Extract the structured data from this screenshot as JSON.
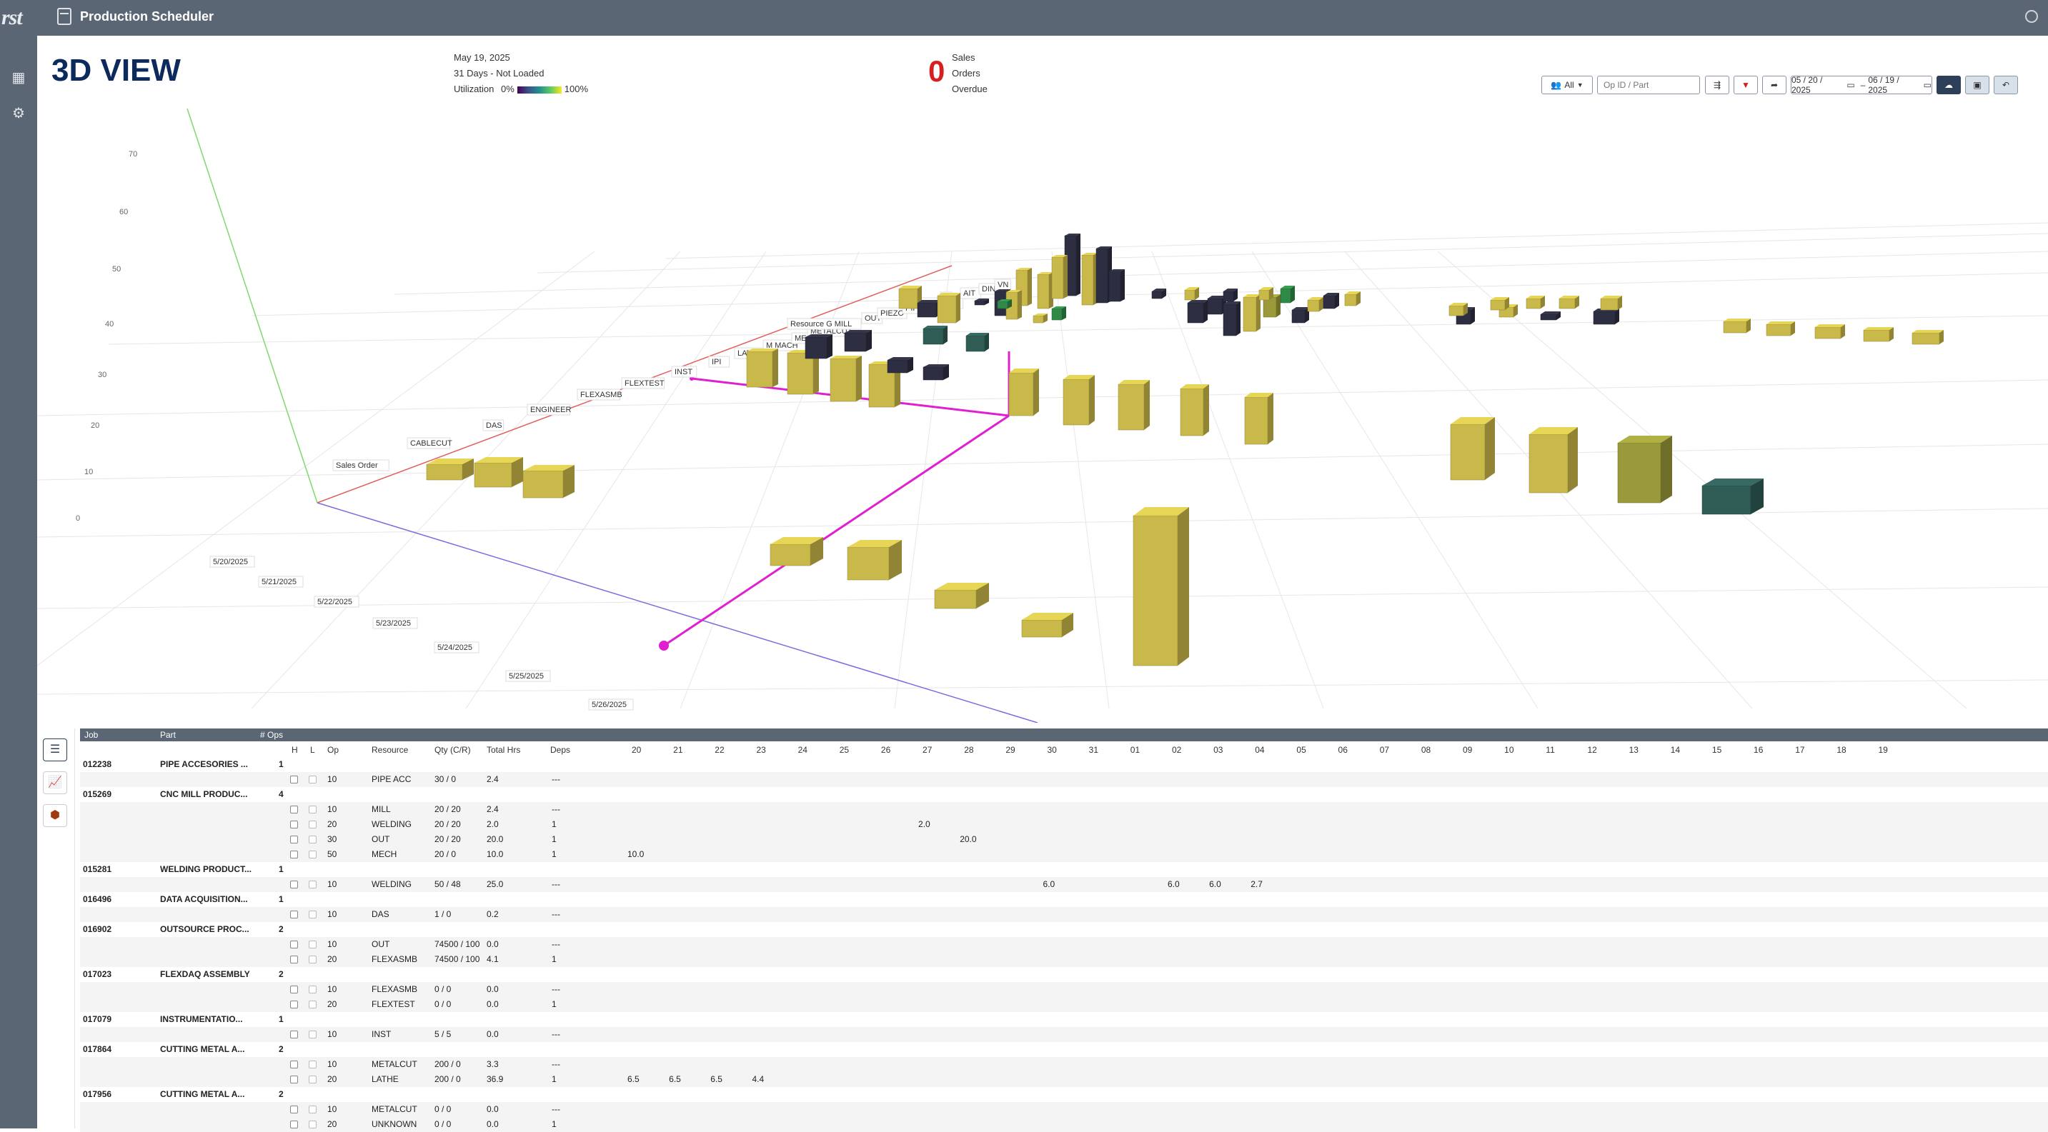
{
  "app": {
    "logo": "rst",
    "title": "Production Scheduler"
  },
  "sidebar": {
    "items": [
      {
        "name": "calendar-icon"
      },
      {
        "name": "tools-icon"
      }
    ]
  },
  "header": {
    "view_title": "3D VIEW",
    "date": "May 19, 2025",
    "days": "31 Days - Not Loaded",
    "utilization_label": "Utilization",
    "utilization_min": "0%",
    "utilization_max": "100%",
    "overdue_count": "0",
    "overdue_lines": [
      "Sales",
      "Orders",
      "Overdue"
    ]
  },
  "toolbar": {
    "filter_all": "All",
    "search_placeholder": "Op ID / Part",
    "date_from": "05 / 20 / 2025",
    "date_sep": "–",
    "date_to": "06 / 19 / 2025"
  },
  "scene": {
    "y_ticks": [
      "70",
      "60",
      "50",
      "40",
      "30",
      "20",
      "10",
      "0"
    ],
    "resource_labels": [
      "Sales Order",
      "CABLECUT",
      "DAS",
      "ENGINEER",
      "FLEXASMB",
      "FLEXTEST",
      "INST",
      "IPI",
      "LATHE",
      "M MACH",
      "MECH",
      "METALCUT",
      "Resource G MILL",
      "OUT",
      "PIEZO",
      "PIPE",
      "PIPE ACC",
      "P",
      "AIT",
      "DING",
      "VN"
    ],
    "date_labels": [
      "5/20/2025",
      "5/21/2025",
      "5/22/2025",
      "5/23/2025",
      "5/24/2025",
      "5/25/2025",
      "5/26/2025"
    ],
    "colors": {
      "yellow": "#c9b94a",
      "dark": "#2e2e42",
      "teal": "#2f5c55",
      "green": "#2f8a48",
      "olive": "#9a9a3a",
      "magenta": "#e020d0"
    }
  },
  "grid": {
    "header": {
      "job": "Job",
      "part": "Part",
      "ops": "# Ops"
    },
    "columns": {
      "h": "H",
      "l": "L",
      "op": "Op",
      "resource": "Resource",
      "qty": "Qty (C/R)",
      "total": "Total Hrs",
      "deps": "Deps"
    },
    "days": [
      "20",
      "21",
      "22",
      "23",
      "24",
      "25",
      "26",
      "27",
      "28",
      "29",
      "30",
      "31",
      "01",
      "02",
      "03",
      "04",
      "05",
      "06",
      "07",
      "08",
      "09",
      "10",
      "11",
      "12",
      "13",
      "14",
      "15",
      "16",
      "17",
      "18",
      "19"
    ],
    "rows": [
      {
        "type": "job",
        "job": "012238",
        "part": "PIPE ACCESORIES ...",
        "ops": "1"
      },
      {
        "type": "op",
        "op": "10",
        "resource": "PIPE ACC",
        "qty": "30 / 0",
        "total": "2.4",
        "deps": "---",
        "cells": {}
      },
      {
        "type": "job",
        "job": "015269",
        "part": "CNC MILL PRODUC...",
        "ops": "4"
      },
      {
        "type": "op",
        "op": "10",
        "resource": "MILL",
        "qty": "20 / 20",
        "total": "2.4",
        "deps": "---",
        "cells": {}
      },
      {
        "type": "op",
        "op": "20",
        "resource": "WELDING",
        "qty": "20 / 20",
        "total": "2.0",
        "deps": "1",
        "cells": {
          "7": "2.0"
        }
      },
      {
        "type": "op",
        "op": "30",
        "resource": "OUT",
        "qty": "20 / 20",
        "total": "20.0",
        "deps": "1",
        "cells": {
          "8": "20.0"
        }
      },
      {
        "type": "op",
        "op": "50",
        "resource": "MECH",
        "qty": "20 / 0",
        "total": "10.0",
        "deps": "1",
        "cells": {
          "0": "10.0"
        }
      },
      {
        "type": "job",
        "job": "015281",
        "part": "WELDING PRODUCT...",
        "ops": "1"
      },
      {
        "type": "op",
        "op": "10",
        "resource": "WELDING",
        "qty": "50 / 48",
        "total": "25.0",
        "deps": "---",
        "cells": {
          "10": "6.0",
          "13": "6.0",
          "14": "6.0",
          "15": "2.7"
        }
      },
      {
        "type": "job",
        "job": "016496",
        "part": "DATA ACQUISITION...",
        "ops": "1"
      },
      {
        "type": "op",
        "op": "10",
        "resource": "DAS",
        "qty": "1 / 0",
        "total": "0.2",
        "deps": "---",
        "cells": {}
      },
      {
        "type": "job",
        "job": "016902",
        "part": "OUTSOURCE PROC...",
        "ops": "2"
      },
      {
        "type": "op",
        "op": "10",
        "resource": "OUT",
        "qty": "74500 / 100",
        "total": "0.0",
        "deps": "---",
        "cells": {}
      },
      {
        "type": "op",
        "op": "20",
        "resource": "FLEXASMB",
        "qty": "74500 / 100",
        "total": "4.1",
        "deps": "1",
        "cells": {}
      },
      {
        "type": "job",
        "job": "017023",
        "part": "FLEXDAQ ASSEMBLY",
        "ops": "2"
      },
      {
        "type": "op",
        "op": "10",
        "resource": "FLEXASMB",
        "qty": "0 / 0",
        "total": "0.0",
        "deps": "---",
        "cells": {}
      },
      {
        "type": "op",
        "op": "20",
        "resource": "FLEXTEST",
        "qty": "0 / 0",
        "total": "0.0",
        "deps": "1",
        "cells": {}
      },
      {
        "type": "job",
        "job": "017079",
        "part": "INSTRUMENTATIO...",
        "ops": "1"
      },
      {
        "type": "op",
        "op": "10",
        "resource": "INST",
        "qty": "5 / 5",
        "total": "0.0",
        "deps": "---",
        "cells": {}
      },
      {
        "type": "job",
        "job": "017864",
        "part": "CUTTING METAL A...",
        "ops": "2"
      },
      {
        "type": "op",
        "op": "10",
        "resource": "METALCUT",
        "qty": "200 / 0",
        "total": "3.3",
        "deps": "---",
        "cells": {}
      },
      {
        "type": "op",
        "op": "20",
        "resource": "LATHE",
        "qty": "200 / 0",
        "total": "36.9",
        "deps": "1",
        "cells": {
          "0": "6.5",
          "1": "6.5",
          "2": "6.5",
          "3": "4.4"
        }
      },
      {
        "type": "job",
        "job": "017956",
        "part": "CUTTING METAL A...",
        "ops": "2"
      },
      {
        "type": "op",
        "op": "10",
        "resource": "METALCUT",
        "qty": "0 / 0",
        "total": "0.0",
        "deps": "---",
        "cells": {}
      },
      {
        "type": "op",
        "op": "20",
        "resource": "UNKNOWN",
        "qty": "0 / 0",
        "total": "0.0",
        "deps": "1",
        "cells": {}
      }
    ]
  }
}
